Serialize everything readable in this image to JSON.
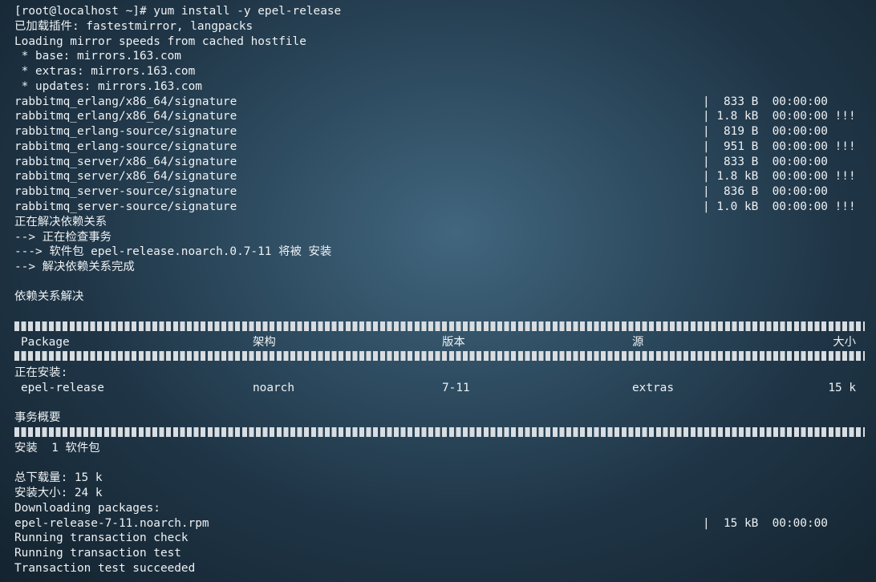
{
  "terminal": {
    "header_lines": [
      "[root@localhost ~]# yum install -y epel-release",
      "已加载插件: fastestmirror, langpacks",
      "Loading mirror speeds from cached hostfile",
      " * base: mirrors.163.com",
      " * extras: mirrors.163.com",
      " * updates: mirrors.163.com"
    ],
    "signatures": [
      {
        "name": "rabbitmq_erlang/x86_64/signature",
        "size": "|  833 B  00:00:00"
      },
      {
        "name": "rabbitmq_erlang/x86_64/signature",
        "size": "| 1.8 kB  00:00:00 !!!"
      },
      {
        "name": "rabbitmq_erlang-source/signature",
        "size": "|  819 B  00:00:00"
      },
      {
        "name": "rabbitmq_erlang-source/signature",
        "size": "|  951 B  00:00:00 !!!"
      },
      {
        "name": "rabbitmq_server/x86_64/signature",
        "size": "|  833 B  00:00:00"
      },
      {
        "name": "rabbitmq_server/x86_64/signature",
        "size": "| 1.8 kB  00:00:00 !!!"
      },
      {
        "name": "rabbitmq_server-source/signature",
        "size": "|  836 B  00:00:00"
      },
      {
        "name": "rabbitmq_server-source/signature",
        "size": "| 1.0 kB  00:00:00 !!!"
      }
    ],
    "resolve_lines": [
      "正在解决依赖关系",
      "--> 正在检查事务",
      "---> 软件包 epel-release.noarch.0.7-11 将被 安装",
      "--> 解决依赖关系完成"
    ],
    "deps_resolved": "依赖关系解决",
    "table_headers": {
      "package": "Package",
      "arch": "架构",
      "version": "版本",
      "repo": "源",
      "size": "大小"
    },
    "installing_label": "正在安装:",
    "package_row": {
      "name": "epel-release",
      "arch": "noarch",
      "version": "7-11",
      "repo": "extras",
      "size": "15 k"
    },
    "summary_title": "事务概要",
    "install_count": "安装  1 软件包",
    "total_download": "总下载量: 15 k",
    "install_size": "安装大小: 24 k",
    "downloading": "Downloading packages:",
    "rpm_name": "epel-release-7-11.noarch.rpm",
    "rpm_progress": "|  15 kB  00:00:00",
    "footer_lines": [
      "Running transaction check",
      "Running transaction test",
      "Transaction test succeeded"
    ]
  }
}
